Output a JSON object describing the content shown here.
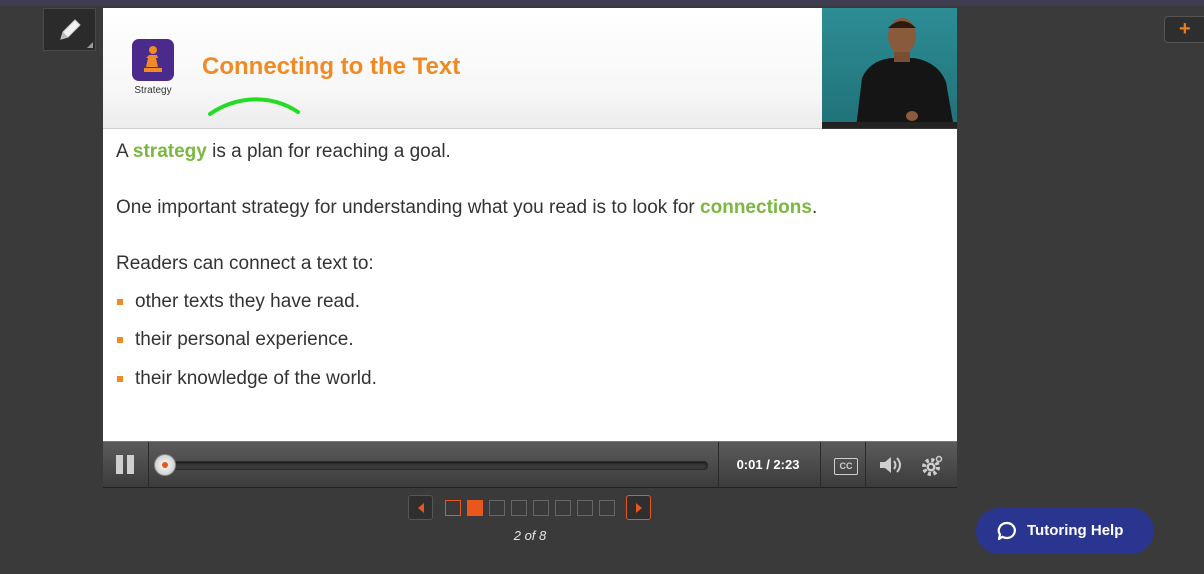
{
  "toolbar": {
    "pencil_icon": "pencil-icon",
    "plus_label": "+"
  },
  "slide": {
    "icon_label": "Strategy",
    "title": "Connecting to the Text",
    "para1": {
      "a": "A ",
      "hl": "strategy",
      "b": " is a plan for reaching a goal."
    },
    "para2": {
      "a": "One important strategy for understanding what you read is to look for ",
      "hl": "connections",
      "b": "."
    },
    "para3": "Readers can connect a text to:",
    "bullets": [
      "other texts they have read.",
      "their personal experience.",
      "their knowledge of the world."
    ]
  },
  "player": {
    "time": "0:01 / 2:23",
    "cc_label": "CC",
    "progress": 0.007
  },
  "pager": {
    "total": 8,
    "current": 2,
    "label": "2 of 8"
  },
  "tutoring": {
    "label": "Tutoring Help"
  },
  "colors": {
    "accent": "#f08a24",
    "highlight": "#7ab83f",
    "tutor_bg": "#2a3590",
    "icon_bg": "#4a2a8a"
  }
}
